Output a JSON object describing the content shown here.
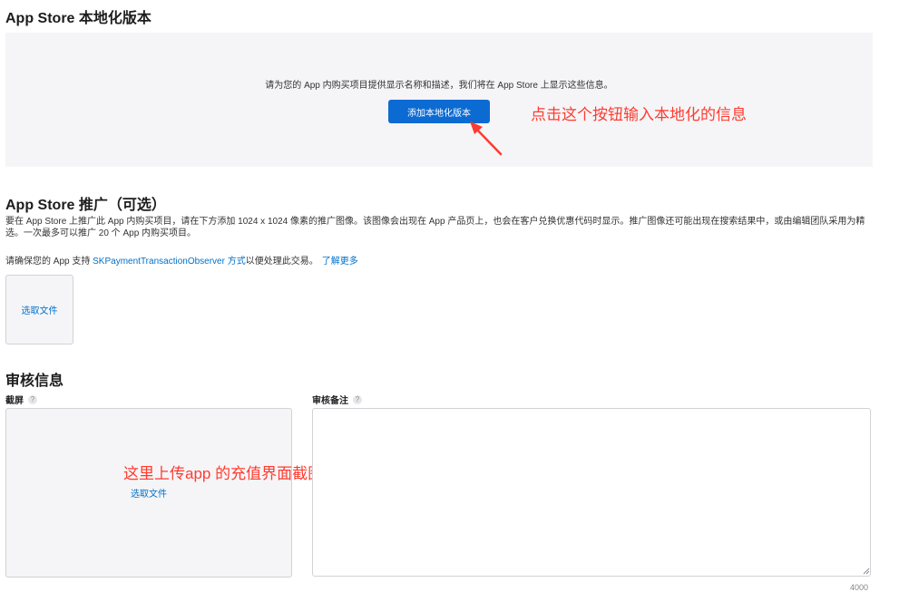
{
  "localization": {
    "title": "App Store 本地化版本",
    "description": "请为您的 App 内购买项目提供显示名称和描述，我们将在 App Store 上显示这些信息。",
    "add_button": "添加本地化版本",
    "annotation": "点击这个按钮输入本地化的信息"
  },
  "promotion": {
    "title": "App Store 推广（可选）",
    "description": "要在 App Store 上推广此 App 内购买项目，请在下方添加 1024 x 1024 像素的推广图像。该图像会出现在 App 产品页上，也会在客户兑换优惠代码时显示。推广图像还可能出现在搜索结果中，或由编辑团队采用为精选。一次最多可以推广 20 个 App 内购买项目。",
    "note_prefix": "请确保您的 App 支持 ",
    "note_link": "SKPaymentTransactionObserver 方式",
    "note_mid": "以便处理此交易。",
    "learn_more": "了解更多",
    "choose_file": "选取文件"
  },
  "review": {
    "title": "审核信息",
    "screenshot_label": "截屏",
    "notes_label": "审核备注",
    "help_glyph": "?",
    "choose_file": "选取文件",
    "annotation": "这里上传app 的充值界面截图即可",
    "notes_value": "",
    "char_limit": "4000"
  },
  "colors": {
    "accent": "#0b6bd3",
    "link": "#0070c9",
    "annotation": "#ff3b30",
    "panel": "#f5f5f7"
  }
}
